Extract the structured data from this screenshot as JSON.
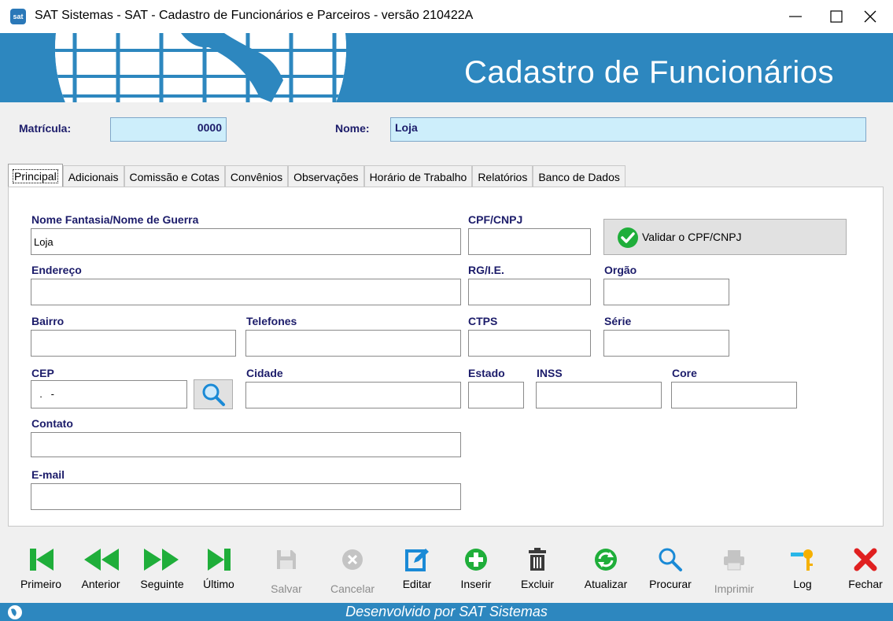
{
  "window": {
    "title": "SAT Sistemas - SAT - Cadastro de Funcionários e Parceiros - versão 210422A",
    "icon_label": "sat"
  },
  "banner": {
    "title": "Cadastro de Funcionários"
  },
  "header": {
    "matricula_label": "Matrícula:",
    "matricula_value": "0000",
    "nome_label": "Nome:",
    "nome_value": "Loja"
  },
  "tabs": [
    {
      "label": "Principal"
    },
    {
      "label": "Adicionais"
    },
    {
      "label": "Comissão e Cotas"
    },
    {
      "label": "Convênios"
    },
    {
      "label": "Observações"
    },
    {
      "label": "Horário de Trabalho"
    },
    {
      "label": "Relatórios"
    },
    {
      "label": "Banco de Dados"
    }
  ],
  "form": {
    "nome_fantasia": {
      "label": "Nome Fantasia/Nome de Guerra",
      "value": "Loja"
    },
    "cpf_cnpj": {
      "label": "CPF/CNPJ",
      "value": ""
    },
    "validate_button": "Validar o CPF/CNPJ",
    "endereco": {
      "label": "Endereço",
      "value": ""
    },
    "rg_ie": {
      "label": "RG/I.E.",
      "value": ""
    },
    "orgao": {
      "label": "Orgão",
      "value": ""
    },
    "bairro": {
      "label": "Bairro",
      "value": ""
    },
    "telefones": {
      "label": "Telefones",
      "value": ""
    },
    "ctps": {
      "label": "CTPS",
      "value": ""
    },
    "serie": {
      "label": "Série",
      "value": ""
    },
    "cep": {
      "label": "CEP",
      "value": "  .   -"
    },
    "cidade": {
      "label": "Cidade",
      "value": ""
    },
    "estado": {
      "label": "Estado",
      "value": ""
    },
    "inss": {
      "label": "INSS",
      "value": ""
    },
    "core": {
      "label": "Core",
      "value": ""
    },
    "contato": {
      "label": "Contato",
      "value": ""
    },
    "email": {
      "label": "E-mail",
      "value": ""
    }
  },
  "toolbar": {
    "primeiro": "Primeiro",
    "anterior": "Anterior",
    "seguinte": "Seguinte",
    "ultimo": "Último",
    "salvar": "Salvar",
    "cancelar": "Cancelar",
    "editar": "Editar",
    "inserir": "Inserir",
    "excluir": "Excluir",
    "atualizar": "Atualizar",
    "procurar": "Procurar",
    "imprimir": "Imprimir",
    "log": "Log",
    "fechar": "Fechar"
  },
  "status": {
    "text": "Desenvolvido por SAT Sistemas"
  },
  "colors": {
    "banner": "#2d87bf",
    "label_text": "#1c1c6a",
    "highlight_field": "#cdeefb",
    "nav_green": "#1fae3a",
    "close_red": "#e02020"
  }
}
